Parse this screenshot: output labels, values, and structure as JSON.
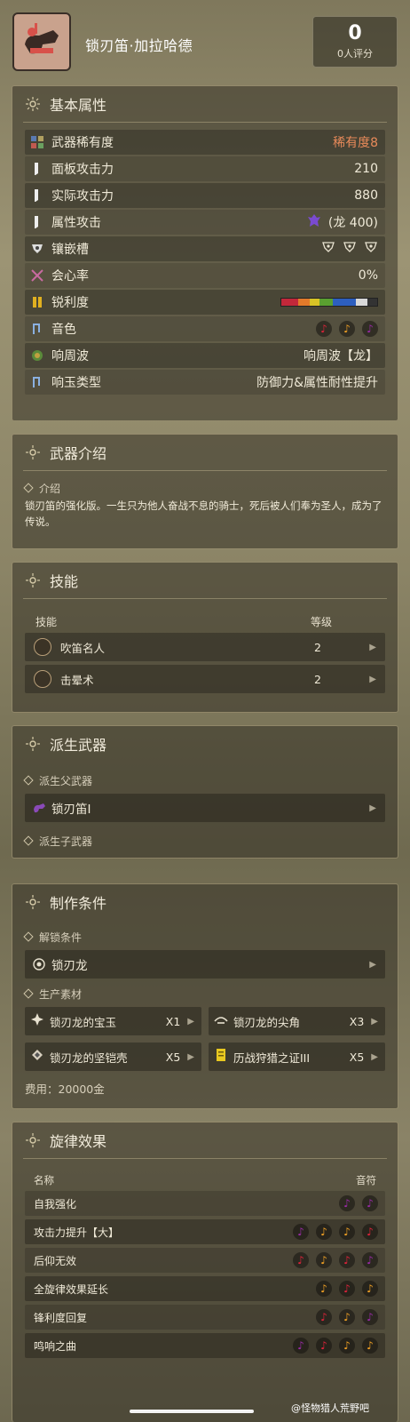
{
  "header": {
    "weapon_name": "锁刃笛·加拉哈德",
    "rating_count": "0",
    "rating_label": "0人评分"
  },
  "attributes": {
    "title": "基本属性",
    "rows": [
      {
        "label": "武器稀有度",
        "value": "稀有度8",
        "icon": "rarity-grid-icon",
        "value_color": "#e88a5a"
      },
      {
        "label": "面板攻击力",
        "value": "210",
        "icon": "blade-icon"
      },
      {
        "label": "实际攻击力",
        "value": "880",
        "icon": "blade-icon"
      },
      {
        "label": "属性攻击",
        "value": "(龙 400)",
        "icon": "blade-icon",
        "value_icon": "dragon-element-icon"
      },
      {
        "label": "镶嵌槽",
        "value": "",
        "icon": "slot-icon"
      },
      {
        "label": "会心率",
        "value": "0%",
        "icon": "crit-icon"
      },
      {
        "label": "锐利度",
        "value": "",
        "icon": "sharpness-icon"
      },
      {
        "label": "音色",
        "value": "",
        "icon": "melody-icon"
      },
      {
        "label": "响周波",
        "value": "响周波【龙】",
        "icon": "echo-wave-icon"
      },
      {
        "label": "响玉类型",
        "value": "防御力&属性耐性提升",
        "icon": "melody-icon"
      }
    ],
    "sharpness_segments": [
      {
        "color": "#c2283a",
        "fraction": 0.18
      },
      {
        "color": "#e27a2a",
        "fraction": 0.12
      },
      {
        "color": "#d8c326",
        "fraction": 0.1
      },
      {
        "color": "#5aa030",
        "fraction": 0.14
      },
      {
        "color": "#2d5fbf",
        "fraction": 0.24
      },
      {
        "color": "#d8d8d8",
        "fraction": 0.12
      },
      {
        "color": "#333333",
        "fraction": 0.1
      }
    ],
    "notes_colors": [
      "#e0223a",
      "#f0a024",
      "#9a2aa8"
    ]
  },
  "intro": {
    "title": "武器介绍",
    "sub": "介绍",
    "text": "锁刃笛的强化版。一生只为他人奋战不息的骑士，死后被人们奉为圣人，成为了传说。"
  },
  "skills": {
    "title": "技能",
    "col_name": "技能",
    "col_level": "等级",
    "rows": [
      {
        "name": "吹笛名人",
        "level": "2"
      },
      {
        "name": "击晕术",
        "level": "2"
      }
    ]
  },
  "derive": {
    "title": "派生武器",
    "parent_label": "派生父武器",
    "parent_weapon": "锁刃笛I",
    "child_label": "派生子武器"
  },
  "craft": {
    "title": "制作条件",
    "unlock_label": "解锁条件",
    "unlock_value": "锁刃龙",
    "material_label": "生产素材",
    "materials": [
      {
        "name": "锁刃龙的宝玉",
        "qty": "X1"
      },
      {
        "name": "锁刃龙的尖角",
        "qty": "X3"
      },
      {
        "name": "锁刃龙的坚铠壳",
        "qty": "X5"
      },
      {
        "name": "历战狩猎之证III",
        "qty": "X5"
      }
    ],
    "cost": "费用：20000金"
  },
  "melody": {
    "title": "旋律效果",
    "col_name": "名称",
    "col_notes": "音符",
    "rows": [
      {
        "name": "自我强化",
        "notes": [
          "#9a2aa8",
          "#9a2aa8"
        ]
      },
      {
        "name": "攻击力提升【大】",
        "notes": [
          "#9a2aa8",
          "#f0a024",
          "#f0a024",
          "#e0223a"
        ]
      },
      {
        "name": "后仰无效",
        "notes": [
          "#e0223a",
          "#f0a024",
          "#e0223a",
          "#9a2aa8"
        ]
      },
      {
        "name": "全旋律效果延长",
        "notes": [
          "#f0a024",
          "#e0223a",
          "#f0a024"
        ]
      },
      {
        "name": "锋利度回复",
        "notes": [
          "#e0223a",
          "#f0a024",
          "#9a2aa8"
        ]
      },
      {
        "name": "鸣响之曲",
        "notes": [
          "#9a2aa8",
          "#e0223a",
          "#f0a024",
          "#f0a024"
        ]
      }
    ]
  },
  "watermark": "@怪物猎人荒野吧"
}
